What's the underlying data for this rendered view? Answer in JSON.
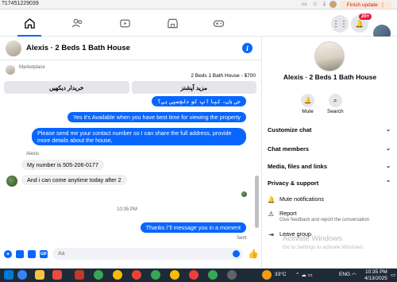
{
  "browser": {
    "url": "?17451229039",
    "finish_update": "Finish update",
    "colors": {
      "finish_text": "#b3261e",
      "finish_bg": "#fde7d8"
    }
  },
  "topnav": {
    "icons": [
      "home-icon",
      "friends-icon",
      "video-icon",
      "gaming-icon"
    ],
    "notification_badge": "20+"
  },
  "chat": {
    "title": "Alexis · 2 Beds 1 Bath House",
    "marketplace_label": "Marketplace",
    "listing": "2 Beds 1 Bath House - $700",
    "buttons": {
      "see_more": "مزید آپشنز",
      "buyer_view": "خریدار دیکھیں"
    },
    "messages": {
      "urdu_question": "جی ہاں، کیا آپ کو دلچسپی ہے؟",
      "available": "Yes it's Available when you have best time for viewing the property",
      "send_number": "Please send me your contact number so I can share the full address, provide more details about the house,",
      "sender": "Alexis",
      "my_number": "My number is 505-206-0177",
      "come_anytime": "And i can come anytime today after 2",
      "timestamp": "10:35 PM",
      "thanks": "Thanks i\"ll message you in a moment",
      "sent": "Sent"
    },
    "composer": {
      "placeholder": "Aa"
    },
    "colors": {
      "accent": "#0866ff",
      "incoming_bubble": "#f0f0f0"
    }
  },
  "side": {
    "name": "Alexis · 2 Beds 1 Bath House",
    "mute": "Mute",
    "search": "Search",
    "sections": {
      "customize": "Customize chat",
      "members": "Chat members",
      "media": "Media, files and links",
      "privacy": "Privacy & support"
    },
    "items": {
      "mute_notifications": "Mute notifications",
      "report": "Report",
      "report_desc": "Give feedback and report the conversation",
      "leave": "Leave group"
    },
    "watermark_title": "Activate Windows",
    "watermark_sub": "Go to Settings to activate Windows."
  },
  "taskbar": {
    "temperature": "33°C",
    "language": "ENG",
    "time": "10:35 PM",
    "date": "4/13/2025"
  }
}
